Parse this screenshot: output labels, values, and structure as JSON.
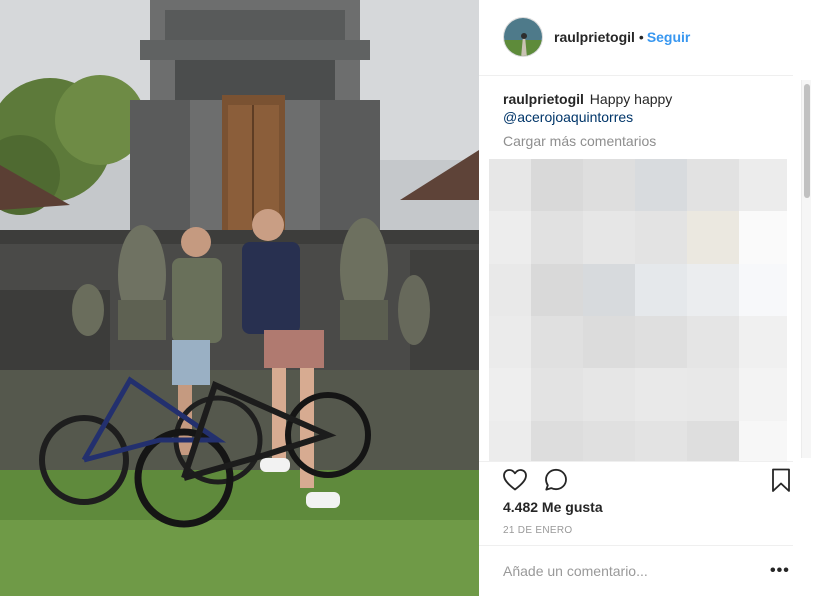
{
  "post": {
    "username": "raulprietogil",
    "separator": "•",
    "follow_label": "Seguir",
    "caption_text": "Happy happy",
    "caption_mention": "@acerojoaquintorres",
    "load_more_label": "Cargar más comentarios",
    "likes_label": "4.482 Me gusta",
    "date_label": "21 DE ENERO",
    "comment_placeholder": "Añade un comentario...",
    "more_options_label": "•••"
  },
  "icons": {
    "like": "heart-icon",
    "comment": "speech-bubble-icon",
    "save": "bookmark-icon",
    "more": "ellipsis-icon"
  },
  "colors": {
    "link_blue": "#3897f0",
    "mention_blue": "#003569",
    "text": "#262626",
    "muted": "#999999",
    "border": "#efefef"
  }
}
